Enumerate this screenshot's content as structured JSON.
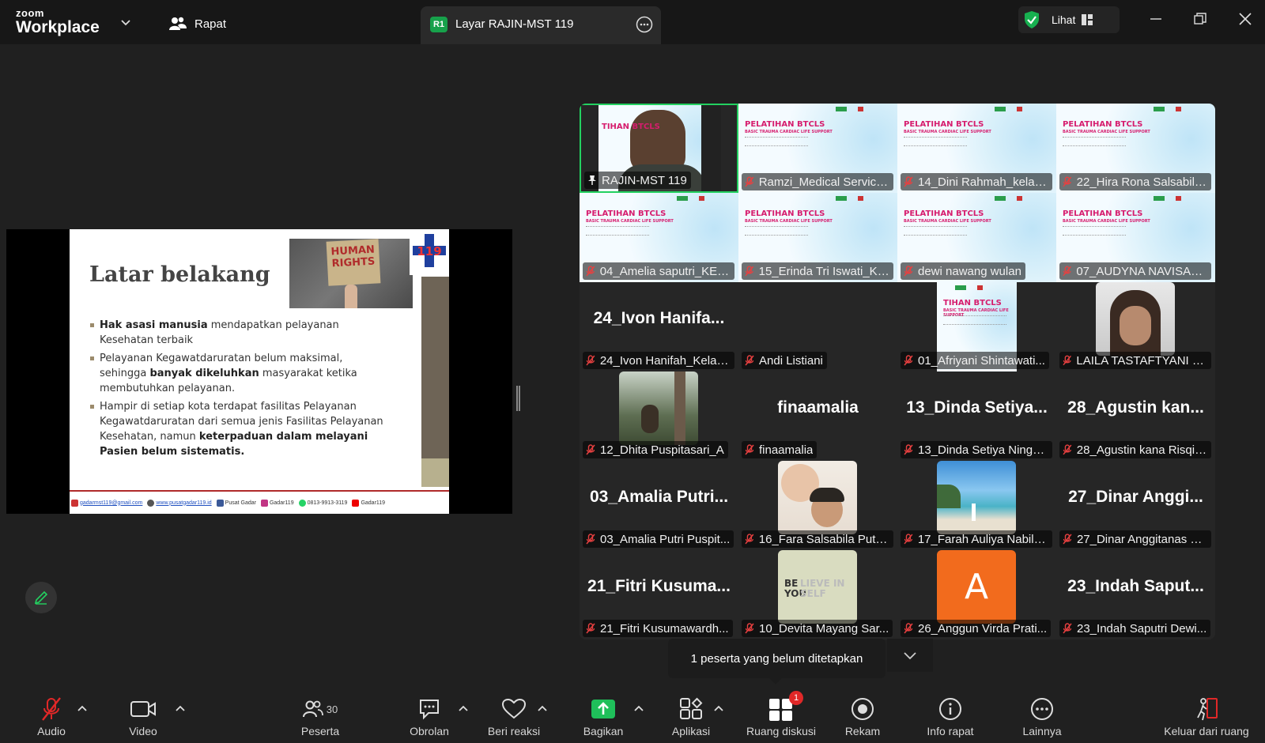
{
  "app": {
    "logo_line1": "zoom",
    "logo_line2": "Workplace",
    "rapat_label": "Rapat",
    "tab_badge": "R1",
    "tab_label": "Layar RAJIN-MST 119",
    "lihat_label": "Lihat"
  },
  "slide": {
    "title": "Latar belakang",
    "image_text": "HUMAN RIGHTS",
    "logo_text": "119",
    "bullets": [
      {
        "bold1": "Hak asasi manusia",
        "text1": " mendapatkan pelayanan Kesehatan terbaik",
        "bold2": "",
        "text2": ""
      },
      {
        "bold1": "",
        "text1": "Pelayanan Kegawatdaruratan belum maksimal, sehingga ",
        "bold2": "banyak dikeluhkan",
        "text2": " masyarakat ketika membutuhkan pelayanan."
      },
      {
        "bold1": "",
        "text1": "Hampir di setiap kota terdapat fasilitas Pelayanan Kegawatdaruratan dari semua jenis Fasilitas Pelayanan Kesehatan, namun ",
        "bold2": "keterpaduan dalam melayani Pasien belum sistematis.",
        "text2": ""
      }
    ],
    "footer": {
      "email": "gadarmst119@gmail.com",
      "web": "www.pusatgadar119.id",
      "facebook": "Pusat Gadar",
      "instagram": "Gadar119",
      "whatsapp": "0813-9913-3119",
      "youtube": "Gadar119"
    }
  },
  "slide_thumb": {
    "title": "PELATIHAN BTCLS",
    "subtitle": "BASIC TRAUMA CARDIAC LIFE SUPPORT",
    "title_cropped": "TIHAN BTCLS"
  },
  "participants": [
    {
      "label": "RAJIN-MST 119",
      "kind": "face",
      "big": "",
      "pinned": true
    },
    {
      "label": "Ramzi_Medical Service...",
      "kind": "slide",
      "big": ""
    },
    {
      "label": "14_Dini Rahmah_kelasA",
      "kind": "slide",
      "big": ""
    },
    {
      "label": "22_Hira Rona Salsabila...",
      "kind": "slide",
      "big": ""
    },
    {
      "label": "04_Amelia saputri_KEL...",
      "kind": "slide",
      "big": ""
    },
    {
      "label": "15_Erinda Tri Iswati_Ke...",
      "kind": "slide",
      "big": ""
    },
    {
      "label": "dewi nawang wulan",
      "kind": "slide",
      "big": ""
    },
    {
      "label": "07_AUDYNA NAVISA_K...",
      "kind": "slide",
      "big": ""
    },
    {
      "label": "24_Ivon Hanifah_Kelas...",
      "kind": "name",
      "big": "24_Ivon  Hanifa..."
    },
    {
      "label": "Andi Listiani",
      "kind": "blank",
      "big": ""
    },
    {
      "label": "01_Afriyani Shintawati...",
      "kind": "slide-narrow",
      "big": ""
    },
    {
      "label": "LAILA TASTAFTYANI NI...",
      "kind": "pic-face",
      "big": ""
    },
    {
      "label": "12_Dhita Puspitasari_A",
      "kind": "pic-forest",
      "big": ""
    },
    {
      "label": "finaamalia",
      "kind": "name",
      "big": "finaamalia"
    },
    {
      "label": "13_Dinda Setiya Nings...",
      "kind": "name",
      "big": "13_Dinda  Setiya..."
    },
    {
      "label": "28_Agustin kana Risqiy...",
      "kind": "name",
      "big": "28_Agustin  kan..."
    },
    {
      "label": "03_Amalia Putri Puspit...",
      "kind": "name",
      "big": "03_Amalia  Putri..."
    },
    {
      "label": "16_Fara Salsabila Putri...",
      "kind": "pic-baby",
      "big": ""
    },
    {
      "label": "17_Farah Auliya Nabila...",
      "kind": "pic-beach",
      "big": ""
    },
    {
      "label": "27_Dinar Anggitanas S...",
      "kind": "name",
      "big": "27_Dinar  Anggi..."
    },
    {
      "label": "21_Fitri Kusumawardh...",
      "kind": "name",
      "big": "21_Fitri  Kusuma..."
    },
    {
      "label": "10_Devita Mayang Sar...",
      "kind": "pic-believe",
      "big": ""
    },
    {
      "label": "26_Anggun Virda Prati...",
      "kind": "pic-letter",
      "big": "A"
    },
    {
      "label": "23_Indah Saputri Dewi...",
      "kind": "name",
      "big": "23_Indah  Saput..."
    }
  ],
  "pic_text": {
    "believe_bold": "BE YOU!",
    "believe_light": "LIEVE IN SELF"
  },
  "tooltip": {
    "text": "1 peserta yang belum ditetapkan"
  },
  "toolbar": {
    "audio": "Audio",
    "video": "Video",
    "peserta": "Peserta",
    "peserta_count": "30",
    "obrolan": "Obrolan",
    "reaksi": "Beri reaksi",
    "bagikan": "Bagikan",
    "aplikasi": "Aplikasi",
    "ruang": "Ruang diskusi",
    "ruang_badge": "1",
    "rekam": "Rekam",
    "info": "Info rapat",
    "lainnya": "Lainnya",
    "keluar": "Keluar dari ruang"
  },
  "colors": {
    "accent_green": "#23d160",
    "muted_red": "#e02828",
    "share_green": "#1fbf5a",
    "background": "#202020"
  },
  "icons": [
    "chevron-down-icon",
    "participants-icon",
    "more-icon",
    "shield-check-icon",
    "grid-view-icon",
    "minimize-icon",
    "restore-icon",
    "close-icon",
    "pencil-icon",
    "mic-muted-icon",
    "video-icon",
    "chat-icon",
    "heart-icon",
    "share-up-icon",
    "apps-icon",
    "breakout-icon",
    "record-icon",
    "info-icon",
    "ellipsis-icon",
    "leave-icon",
    "pin-icon"
  ]
}
